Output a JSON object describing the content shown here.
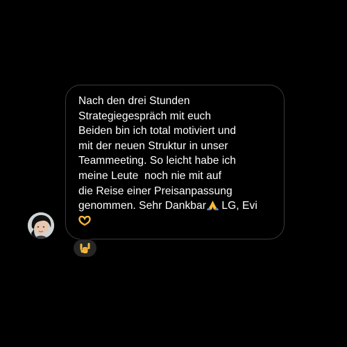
{
  "message": {
    "lines": [
      "Nach den drei Stunden",
      "Strategiegespräch mit euch",
      "Beiden bin ich total motiviert und",
      "mit der neuen Struktur in unser",
      "Teammeeting. So leicht habe ich",
      "meine Leute  noch nie mit auf",
      "die Reise einer Preisanpassung",
      "genommen. Sehr Dankbar"
    ],
    "line8_suffix": " LG, Evi",
    "inline_icons": [
      "folded-hands-icon",
      "heart-hands-icon"
    ]
  },
  "reaction": {
    "icon": "love-you-gesture-icon"
  },
  "avatar": {
    "icon": "profile-photo"
  },
  "colors": {
    "background": "#000000",
    "bubble_border": "#3a3a3a",
    "text": "#ffffff",
    "reaction_bg": "#262626",
    "emoji_skin": "#f5b93b"
  }
}
